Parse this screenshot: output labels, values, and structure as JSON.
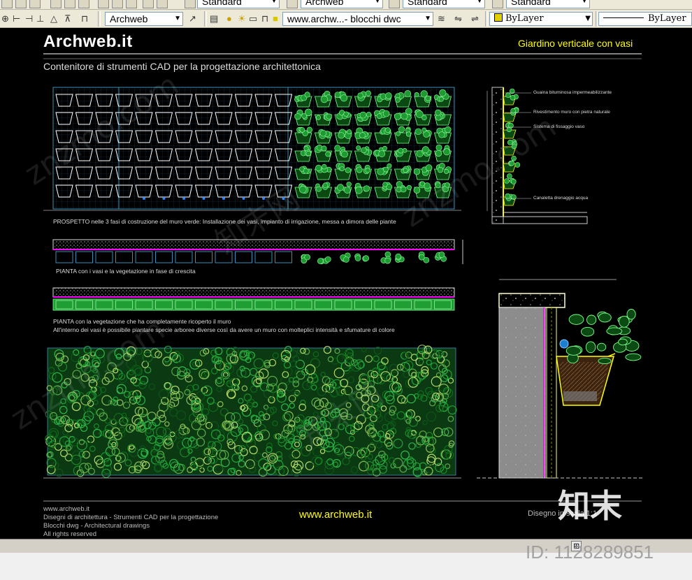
{
  "toolbar_top": {
    "text_style": "Standard",
    "dim_style": "Archweb",
    "table_style": "Standard",
    "mleader_style": "Standard"
  },
  "toolbar_main": {
    "workspace": "Archweb",
    "layer": "www.archw...- blocchi dwc",
    "color": "ByLayer",
    "linetype": "ByLayer"
  },
  "drawing": {
    "brand": "Archweb.it",
    "subtitle": "Contenitore di strumenti CAD per la progettazione architettonica",
    "sheet_title": "Giardino verticale con vasi",
    "label_prospetto": "PROSPETTO  nelle 3 fasi di costruzione del muro verde: Installazione dei vasi, impianto di irrigazione, messa a dimora delle piante",
    "label_pianta1": "PIANTA con i vasi e la vegetazione in fase di crescita",
    "label_pianta2": "PIANTA con la vegetazione che ha completamente ricoperto il muro",
    "label_pianta2b": "All'interno dei vasi è possibile piantare specie arboree diverse così da avere un muro con molteplici intensità e sfumature di colore",
    "section_labels": [
      "Guaina bituminosa impermeabilizzante",
      "Rivestimento muro con pietra naturale",
      "Sistema di fissaggio vaso",
      "Canaletta drenaggio acqua"
    ],
    "footer_lines": [
      "www.archweb.it",
      "Disegni di architettura - Strumenti CAD  per la progettazione",
      "Blocchi dwg - Architectural drawings",
      "All rights reserved"
    ],
    "footer_url": "www.archweb.it",
    "footer_scale": "Disegno in scala 1:1"
  },
  "watermark": {
    "logo": "知末",
    "id_text": "ID: 1128289851"
  },
  "colors": {
    "plant_green": "#22a23a",
    "light_green": "#b6d86a",
    "cad_cyan": "#3a8fb7",
    "accent_yellow": "#ffff00",
    "magenta": "#ff00ff"
  }
}
